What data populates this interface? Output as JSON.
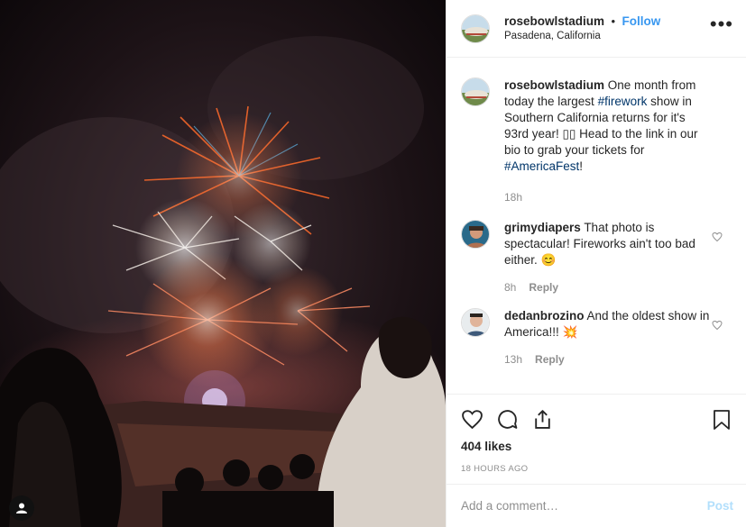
{
  "header": {
    "username": "rosebowlstadium",
    "separator": "•",
    "follow_label": "Follow",
    "location": "Pasadena, California"
  },
  "caption": {
    "username": "rosebowlstadium",
    "text_1": " One month from today the largest ",
    "hashtag_1": "#firework",
    "text_2": " show in Southern California returns for it's 93rd year! ▯▯ Head to the link in our bio to grab your tickets for ",
    "hashtag_2": "#AmericaFest",
    "text_3": "!",
    "time": "18h"
  },
  "comments": [
    {
      "username": "grimydiapers",
      "text": "That photo is spectacular! Fireworks ain't too bad either. 😊",
      "time": "8h",
      "reply": "Reply"
    },
    {
      "username": "dedanbrozino",
      "text": "And the oldest show in America!!! 💥",
      "time": "13h",
      "reply": "Reply"
    }
  ],
  "actions": {
    "likes": "404 likes",
    "timestamp": "18 HOURS AGO"
  },
  "add_comment": {
    "placeholder": "Add a comment…",
    "post_label": "Post"
  },
  "colors": {
    "link": "#3897f0",
    "hashtag": "#003569",
    "muted": "#8e8e8e",
    "post_disabled": "#b2dffc"
  }
}
